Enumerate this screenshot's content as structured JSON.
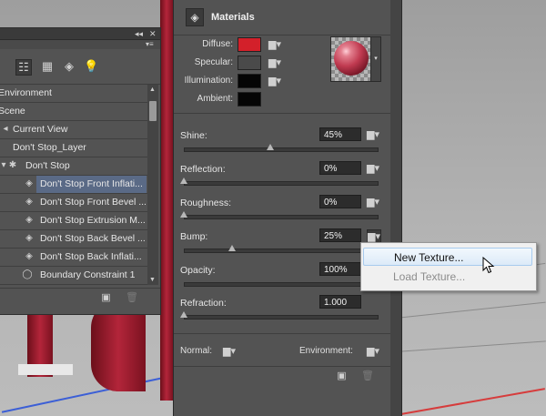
{
  "viewport": {
    "background": "#b3b3b3",
    "object_color": "#b3253a"
  },
  "panel3d": {
    "title_controls": [
      "◂◂",
      "✕"
    ],
    "menu_icon": "panel-menu-icon",
    "toolbar_icons": [
      "scene-filter-icon",
      "mesh-filter-icon",
      "material-filter-icon",
      "light-filter-icon"
    ],
    "tree": [
      {
        "label": "Environment",
        "icon": "",
        "indent": 0
      },
      {
        "label": "Scene",
        "icon": "",
        "indent": 0
      },
      {
        "label": "Current View",
        "icon": "camera-icon",
        "indent": 1
      },
      {
        "label": "Don't Stop_Layer",
        "icon": "",
        "indent": 1
      },
      {
        "label": "Don't Stop",
        "icon": "mesh-icon",
        "indent": 2
      },
      {
        "label": "Don't Stop Front Inflati...",
        "icon": "material-icon",
        "indent": 3,
        "selected": true
      },
      {
        "label": "Don't Stop Front Bevel ...",
        "icon": "material-icon",
        "indent": 3
      },
      {
        "label": "Don't Stop Extrusion M...",
        "icon": "material-icon",
        "indent": 3
      },
      {
        "label": "Don't Stop Back Bevel ...",
        "icon": "material-icon",
        "indent": 3
      },
      {
        "label": "Don't Stop Back Inflati...",
        "icon": "material-icon",
        "indent": 3
      },
      {
        "label": "Boundary Constraint 1",
        "icon": "constraint-icon",
        "indent": 3
      }
    ],
    "footer_icons": [
      "add-object-icon",
      "delete-icon"
    ]
  },
  "materials": {
    "title": "Materials",
    "swatches": [
      {
        "label": "Diffuse:",
        "color": "#d3202a"
      },
      {
        "label": "Specular:",
        "color": "#4a4a4a"
      },
      {
        "label": "Illumination:",
        "color": "#050505"
      },
      {
        "label": "Ambient:",
        "color": "#050505"
      }
    ],
    "properties": [
      {
        "label": "Shine:",
        "value": "45%",
        "fraction": 0.45
      },
      {
        "label": "Reflection:",
        "value": "0%",
        "fraction": 0.0
      },
      {
        "label": "Roughness:",
        "value": "0%",
        "fraction": 0.0
      },
      {
        "label": "Bump:",
        "value": "25%",
        "fraction": 0.25
      },
      {
        "label": "Opacity:",
        "value": "100%",
        "fraction": 1.0
      },
      {
        "label": "Refraction:",
        "value": "1.000",
        "fraction": 0.0
      }
    ],
    "normal_label": "Normal:",
    "environment_label": "Environment:"
  },
  "context_menu": {
    "items": [
      {
        "label": "New Texture...",
        "state": "hover"
      },
      {
        "label": "Load Texture...",
        "state": "disabled"
      }
    ]
  }
}
